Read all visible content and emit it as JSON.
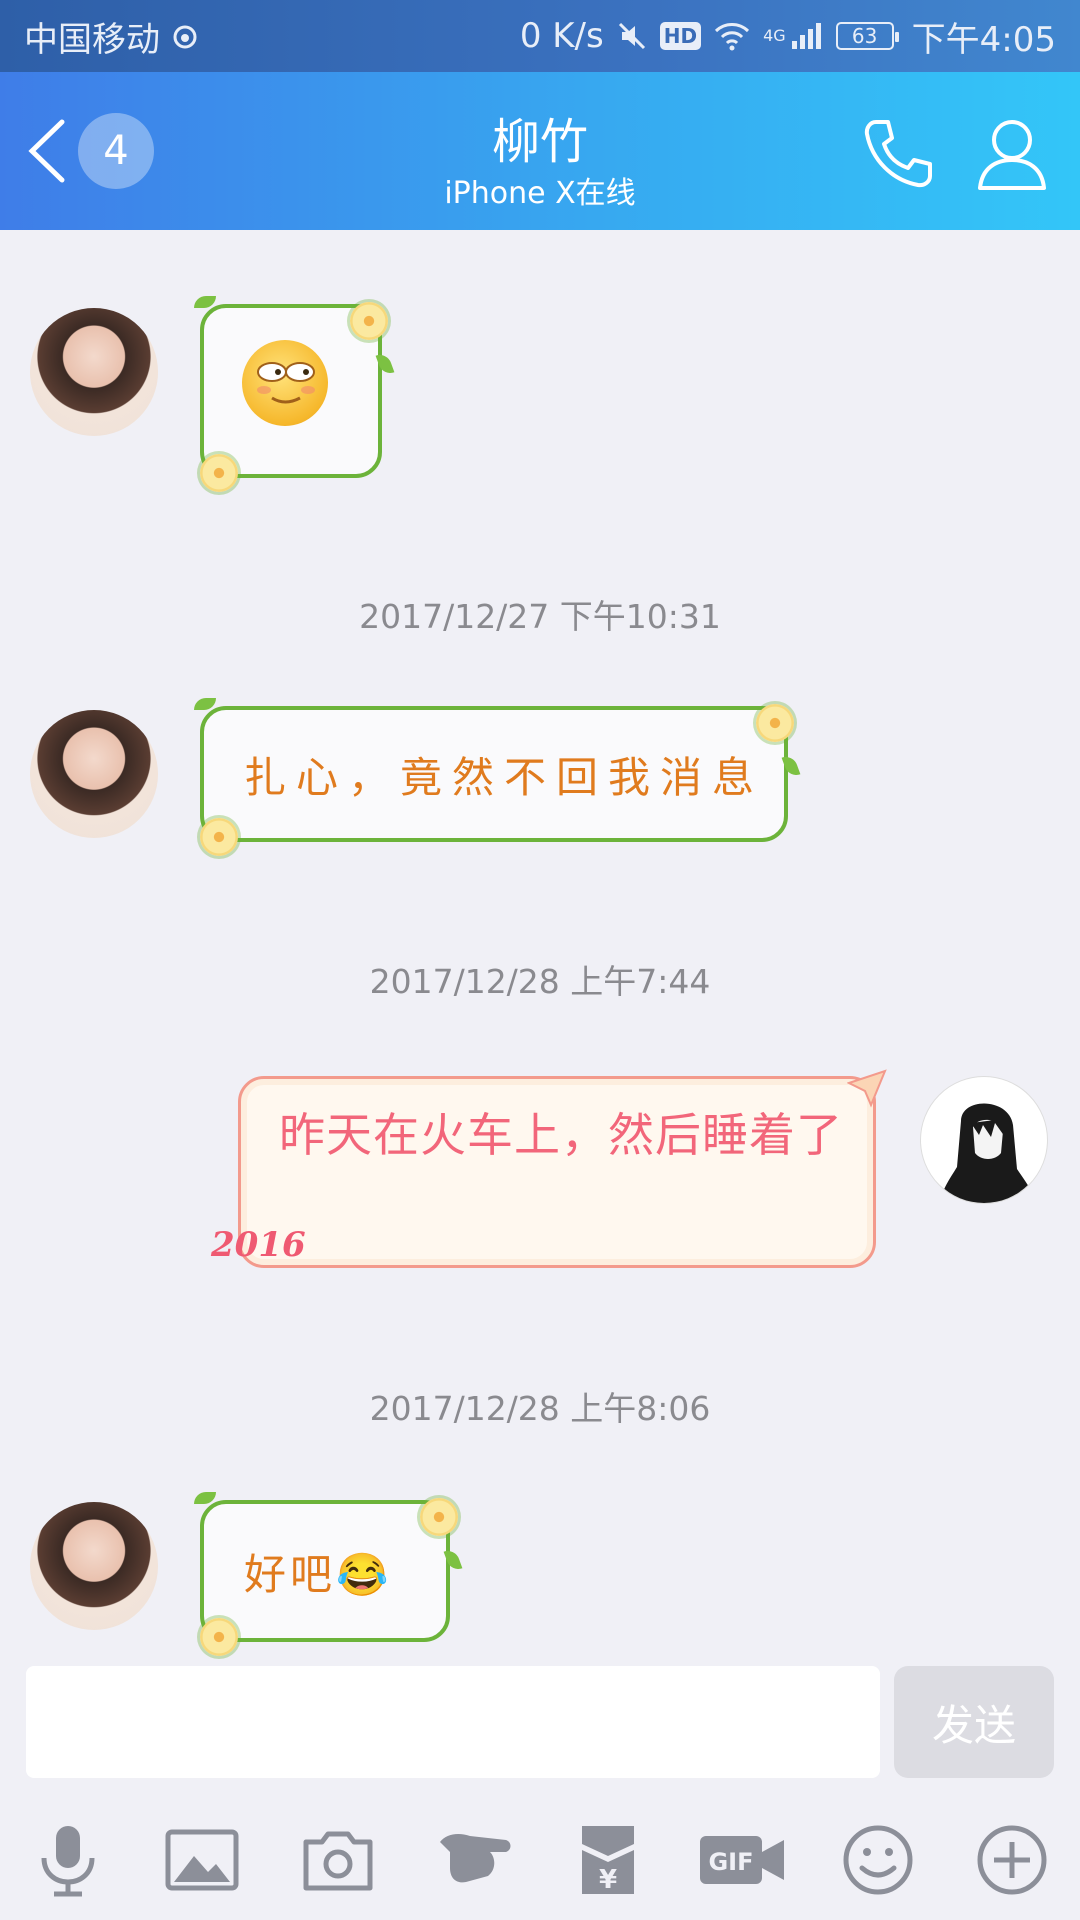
{
  "status_bar": {
    "carrier": "中国移动",
    "speed": "0 K/s",
    "hd": "HD",
    "network": "4G",
    "battery": "63",
    "time": "下午4:05"
  },
  "header": {
    "unread_count": "4",
    "title": "柳竹",
    "subtitle": "iPhone X在线"
  },
  "messages": [
    {
      "sender": "contact",
      "type": "emoji",
      "emoji": "😐"
    },
    {
      "type": "timestamp",
      "text": "2017/12/27 下午10:31"
    },
    {
      "sender": "contact",
      "type": "text",
      "text": "扎心，竟然不回我消息"
    },
    {
      "type": "timestamp",
      "text": "2017/12/28 上午7:44"
    },
    {
      "sender": "me",
      "type": "text",
      "text": "昨天在火车上，然后睡着了",
      "decor": "2016"
    },
    {
      "type": "timestamp",
      "text": "2017/12/28 上午8:06"
    },
    {
      "sender": "contact",
      "type": "text",
      "text": "好吧😂"
    }
  ],
  "input": {
    "value": "",
    "send_label": "发送"
  },
  "toolbar": {
    "gif_label": "GIF",
    "redpacket_label": "¥",
    "icons": [
      "mic-icon",
      "image-icon",
      "camera-icon",
      "poke-icon",
      "red-packet-icon",
      "gif-icon",
      "emoji-icon",
      "plus-icon"
    ]
  },
  "colors": {
    "header_start": "#3f7de8",
    "header_end": "#33c6f8",
    "bubble_border": "#6cb33a",
    "contact_text": "#e07b1e",
    "my_text": "#f2667a"
  }
}
